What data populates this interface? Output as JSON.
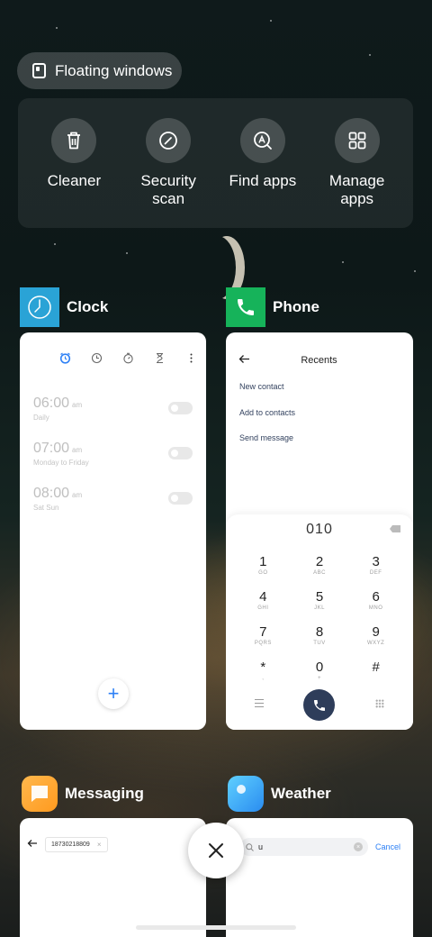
{
  "floating_windows": {
    "label": "Floating windows"
  },
  "quick_actions": [
    {
      "label": "Cleaner",
      "icon": "trash-icon"
    },
    {
      "label": "Security\nscan",
      "icon": "security-scan-icon"
    },
    {
      "label": "Find apps",
      "icon": "find-apps-icon"
    },
    {
      "label": "Manage\napps",
      "icon": "grid-apps-icon"
    }
  ],
  "apps": {
    "clock": {
      "name": "Clock",
      "icon_color": "#2aa3d6",
      "alarms": [
        {
          "time": "06:00",
          "ampm": "am",
          "repeat": "Daily"
        },
        {
          "time": "07:00",
          "ampm": "am",
          "repeat": "Monday to Friday"
        },
        {
          "time": "08:00",
          "ampm": "am",
          "repeat": "Sat Sun"
        }
      ],
      "add_label": "+"
    },
    "phone": {
      "name": "Phone",
      "icon_color": "#16b35a",
      "title": "Recents",
      "links": [
        "New contact",
        "Add to contacts",
        "Send message"
      ],
      "dialed_number": "010",
      "keys": [
        {
          "digit": "1",
          "letters": "GO"
        },
        {
          "digit": "2",
          "letters": "ABC"
        },
        {
          "digit": "3",
          "letters": "DEF"
        },
        {
          "digit": "4",
          "letters": "GHI"
        },
        {
          "digit": "5",
          "letters": "JKL"
        },
        {
          "digit": "6",
          "letters": "MNO"
        },
        {
          "digit": "7",
          "letters": "PQRS"
        },
        {
          "digit": "8",
          "letters": "TUV"
        },
        {
          "digit": "9",
          "letters": "WXYZ"
        },
        {
          "digit": "*",
          "letters": ","
        },
        {
          "digit": "0",
          "letters": "+"
        },
        {
          "digit": "#",
          "letters": ""
        }
      ]
    },
    "messaging": {
      "name": "Messaging",
      "icon_color": "#ffa526",
      "recipient": "18730218809",
      "remove_label": "×"
    },
    "weather": {
      "name": "Weather",
      "icon_color": "#3aa9f5",
      "search_value": "u",
      "cancel_label": "Cancel"
    }
  },
  "colors": {
    "accent": "#2d80f5",
    "call_button": "#2e3d5a"
  }
}
